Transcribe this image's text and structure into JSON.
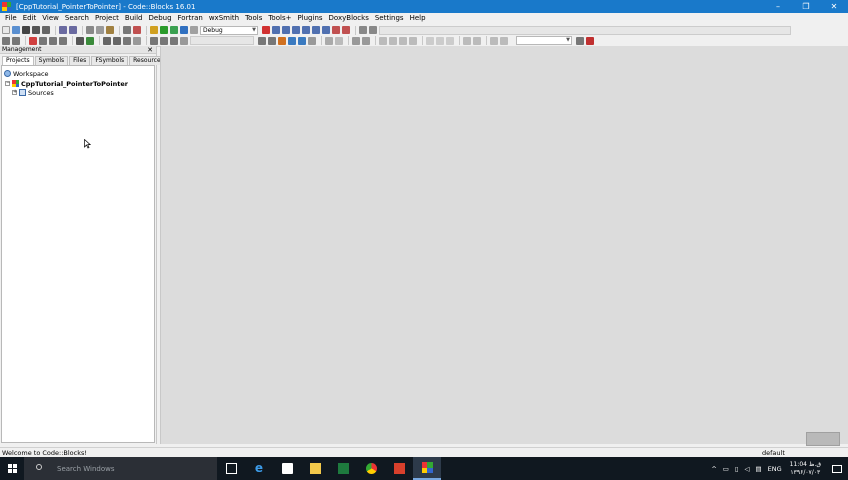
{
  "window": {
    "title": "[CppTutorial_PointerToPointer] - Code::Blocks 16.01",
    "controls": {
      "minimize": "–",
      "maximize": "❐",
      "close": "✕"
    }
  },
  "menu": [
    "File",
    "Edit",
    "View",
    "Search",
    "Project",
    "Build",
    "Debug",
    "Fortran",
    "wxSmith",
    "Tools",
    "Tools+",
    "Plugins",
    "DoxyBlocks",
    "Settings",
    "Help"
  ],
  "toolbar": {
    "build_target": "Debug"
  },
  "management": {
    "title": "Management",
    "close": "✕",
    "tabs": [
      "Projects",
      "Symbols",
      "Files",
      "FSymbols",
      "Resources"
    ],
    "tree": {
      "workspace": "Workspace",
      "project": "CppTutorial_PointerToPointer",
      "folder": "Sources",
      "expand_minus": "−",
      "expand_plus": "+"
    }
  },
  "statusbar": {
    "message": "Welcome to Code::Blocks!",
    "right": "default"
  },
  "taskbar": {
    "search_placeholder": "Search Windows",
    "language": "ENG",
    "time": "11:04 ق.ظ",
    "date": "۱۳۹۶/۰۷/۰۳"
  },
  "colors": {
    "titlebar": "#1979ca",
    "taskbar": "#101820",
    "editor_bg": "#dcdcdc"
  }
}
